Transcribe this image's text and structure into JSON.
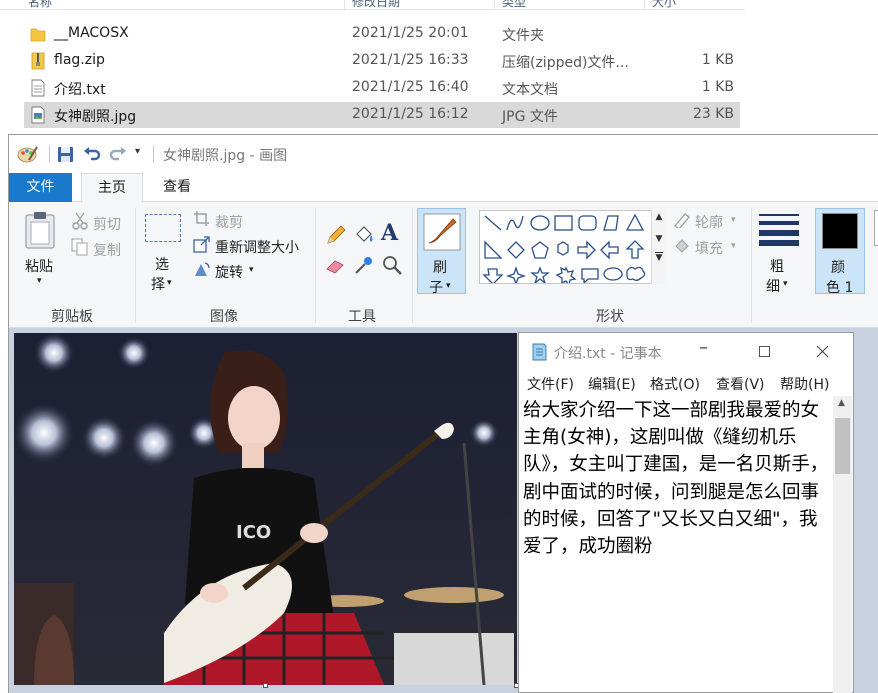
{
  "explorer": {
    "columns": [
      "名称",
      "修改日期",
      "类型",
      "大小"
    ],
    "files": [
      {
        "name": "__MACOSX",
        "date": "2021/1/25 20:01",
        "type": "文件夹",
        "size": "",
        "icon": "folder-icon"
      },
      {
        "name": "flag.zip",
        "date": "2021/1/25 16:33",
        "type": "压缩(zipped)文件...",
        "size": "1 KB",
        "icon": "zip-icon"
      },
      {
        "name": "介绍.txt",
        "date": "2021/1/25 16:40",
        "type": "文本文档",
        "size": "1 KB",
        "icon": "text-file-icon"
      },
      {
        "name": "女神剧照.jpg",
        "date": "2021/1/25 16:12",
        "type": "JPG 文件",
        "size": "23 KB",
        "icon": "image-file-icon"
      }
    ]
  },
  "paint": {
    "title": "女神剧照.jpg - 画图",
    "tabs": {
      "file": "文件",
      "home": "主页",
      "view": "查看"
    },
    "groups": {
      "clipboard": "剪贴板",
      "image": "图像",
      "tools": "工具",
      "shapes": "形状"
    },
    "clipboard": {
      "paste": "粘贴",
      "cut": "剪切",
      "copy": "复制"
    },
    "image": {
      "select_1": "选",
      "select_2": "择",
      "crop": "裁剪",
      "resize": "重新调整大小",
      "rotate": "旋转"
    },
    "brush": {
      "line1": "刷",
      "line2": "子"
    },
    "outline": "轮廓",
    "fill": "填充",
    "size": {
      "line1": "粗",
      "line2": "细"
    },
    "color1": {
      "line1": "颜",
      "line2": "色 1"
    },
    "colors": {
      "accent": "#1979ca",
      "selected_bg": "#cce4f7"
    }
  },
  "notepad": {
    "title": "介绍.txt - 记事本",
    "menu": [
      "文件(F)",
      "编辑(E)",
      "格式(O)",
      "查看(V)",
      "帮助(H)"
    ],
    "content": "给大家介绍一下这一部剧我最爱的女主角(女神)，这剧叫做《缝纫机乐队》，女主叫丁建国，是一名贝斯手，剧中面试的时候，问到腿是怎么回事的时候，回答了\"又长又白又细\"，我爱了，成功圈粉"
  }
}
